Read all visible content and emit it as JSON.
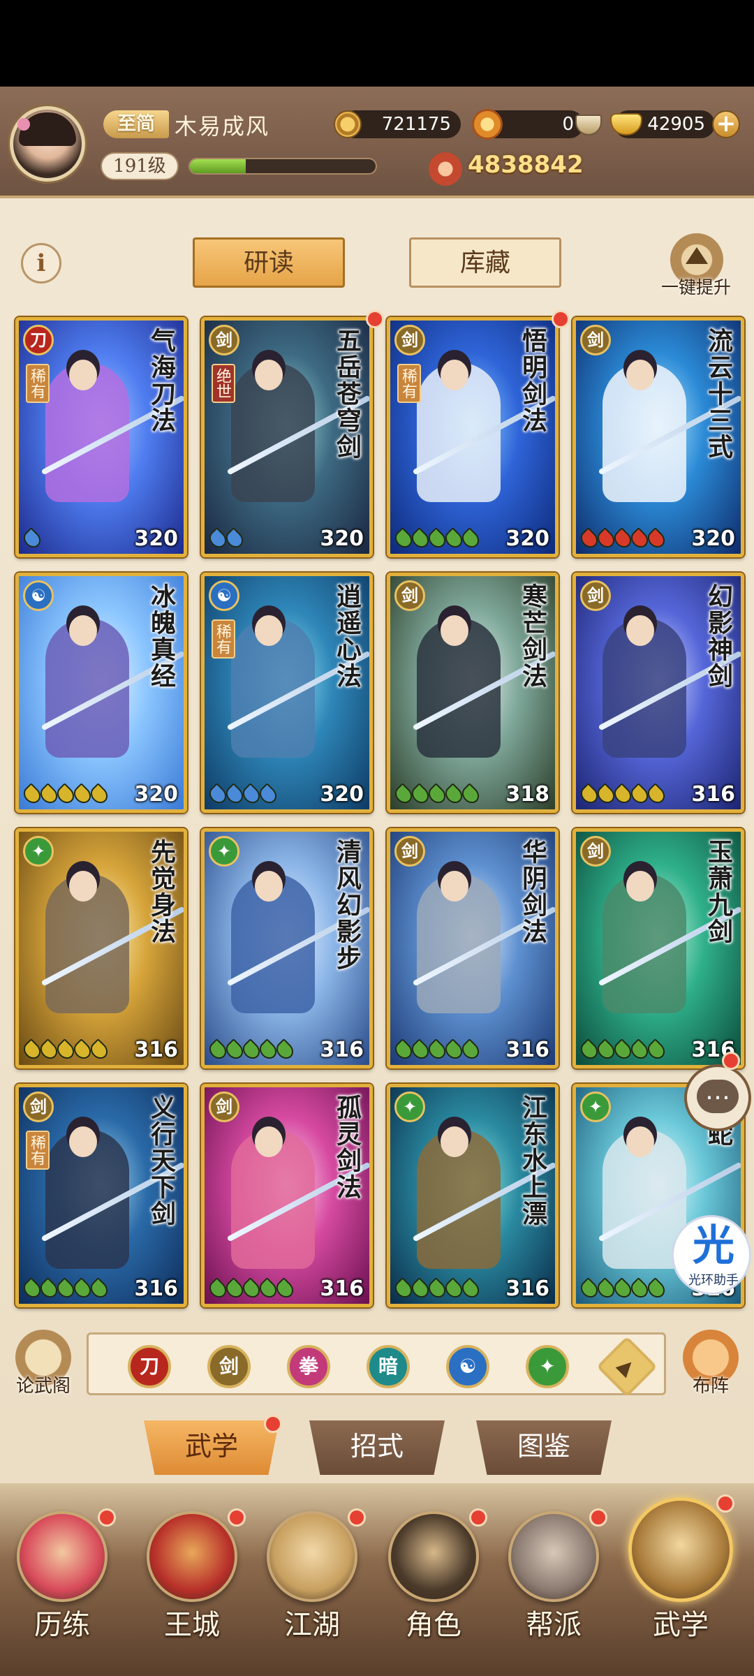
{
  "header": {
    "vip_label": "至简",
    "player_name": "木易成风",
    "level": "191级",
    "exp_progress": 0.3,
    "copper": "721175",
    "spirit": "0",
    "gold": "42905",
    "power": "4838842"
  },
  "tabs": {
    "study": "研读",
    "storage": "库藏",
    "info": "i",
    "upgrade_label": "一键提升"
  },
  "cards": [
    {
      "name": "气海刀法",
      "level": "320",
      "type": "blade",
      "type_glyph": "刀",
      "type_color": "#b8271d",
      "rarity": "稀有",
      "rarity_class": "rare",
      "stars": 1,
      "star_color": "#4a8ad8",
      "palette": [
        "#1d2a8c",
        "#4f7df0",
        "#a9c8ff"
      ],
      "figure": "#b36ee0",
      "badge": false
    },
    {
      "name": "五岳苍穹剑",
      "level": "320",
      "type": "sword",
      "type_glyph": "剑",
      "type_color": "#8a6a28",
      "rarity": "绝世",
      "rarity_class": "peerless",
      "stars": 2,
      "star_color": "#4a8ad8",
      "palette": [
        "#1b2640",
        "#3d6a82",
        "#9bd6d8"
      ],
      "figure": "#3a4452",
      "badge": true
    },
    {
      "name": "悟明剑法",
      "level": "320",
      "type": "sword",
      "type_glyph": "剑",
      "type_color": "#8a6a28",
      "rarity": "稀有",
      "rarity_class": "rare",
      "stars": 5,
      "star_color": "#5ba83a",
      "palette": [
        "#0d2a7a",
        "#2f64d8",
        "#8ad0ff"
      ],
      "figure": "#e8eef8",
      "badge": true
    },
    {
      "name": "流云十三式",
      "level": "320",
      "type": "sword",
      "type_glyph": "剑",
      "type_color": "#8a6a28",
      "rarity": "",
      "rarity_class": "",
      "stars": 5,
      "star_color": "#d83a2a",
      "palette": [
        "#0e2b6a",
        "#2b8ad6",
        "#b6eaff"
      ],
      "figure": "#f0f4fb",
      "badge": false
    },
    {
      "name": "冰魄真经",
      "level": "320",
      "type": "inner",
      "type_glyph": "☯",
      "type_color": "#2a6fc2",
      "rarity": "",
      "rarity_class": "",
      "stars": 5,
      "star_color": "#d8b42a",
      "palette": [
        "#3a7ad6",
        "#8cc6ff",
        "#eaf6ff"
      ],
      "figure": "#6b5fb8",
      "badge": false
    },
    {
      "name": "逍遥心法",
      "level": "320",
      "type": "inner",
      "type_glyph": "☯",
      "type_color": "#2a6fc2",
      "rarity": "稀有",
      "rarity_class": "rare",
      "stars": 4,
      "star_color": "#4a8ad8",
      "palette": [
        "#0e3a64",
        "#2e86b8",
        "#8fe0f0"
      ],
      "figure": "#4d7fb0",
      "badge": false
    },
    {
      "name": "寒芒剑法",
      "level": "318",
      "type": "sword",
      "type_glyph": "剑",
      "type_color": "#8a6a28",
      "rarity": "",
      "rarity_class": "",
      "stars": 5,
      "star_color": "#5ba83a",
      "palette": [
        "#2c3e2a",
        "#7fa89a",
        "#e8f2ee"
      ],
      "figure": "#2b3440",
      "badge": false
    },
    {
      "name": "幻影神剑",
      "level": "316",
      "type": "sword",
      "type_glyph": "剑",
      "type_color": "#8a6a28",
      "rarity": "",
      "rarity_class": "",
      "stars": 5,
      "star_color": "#d8b42a",
      "palette": [
        "#1c2470",
        "#5566d8",
        "#d6ddff"
      ],
      "figure": "#3a4380",
      "badge": false
    },
    {
      "name": "先觉身法",
      "level": "316",
      "type": "move",
      "type_glyph": "✦",
      "type_color": "#3a9a3a",
      "rarity": "",
      "rarity_class": "",
      "stars": 5,
      "star_color": "#d8b42a",
      "palette": [
        "#6a4a14",
        "#d6a43a",
        "#fff2b8"
      ],
      "figure": "#7a6a58",
      "badge": false
    },
    {
      "name": "清风幻影步",
      "level": "316",
      "type": "move",
      "type_glyph": "✦",
      "type_color": "#3a9a3a",
      "rarity": "",
      "rarity_class": "",
      "stars": 5,
      "star_color": "#5ba83a",
      "palette": [
        "#2a4c8a",
        "#8cb6e8",
        "#eaf2ff"
      ],
      "figure": "#3e64a8",
      "badge": false
    },
    {
      "name": "华阴剑法",
      "level": "316",
      "type": "sword",
      "type_glyph": "剑",
      "type_color": "#8a6a28",
      "rarity": "",
      "rarity_class": "",
      "stars": 5,
      "star_color": "#5ba83a",
      "palette": [
        "#1c3a74",
        "#5e90d0",
        "#e6f0ff"
      ],
      "figure": "#9aa8b8",
      "badge": false
    },
    {
      "name": "玉萧九剑",
      "level": "316",
      "type": "sword",
      "type_glyph": "剑",
      "type_color": "#8a6a28",
      "rarity": "",
      "rarity_class": "",
      "stars": 5,
      "star_color": "#5ba83a",
      "palette": [
        "#0b4a3a",
        "#2fb08a",
        "#c6f6e2"
      ],
      "figure": "#4a8a6a",
      "badge": false
    },
    {
      "name": "义行天下剑",
      "level": "316",
      "type": "sword",
      "type_glyph": "剑",
      "type_color": "#8a6a28",
      "rarity": "稀有",
      "rarity_class": "rare",
      "stars": 5,
      "star_color": "#5ba83a",
      "palette": [
        "#0e2c5a",
        "#2a6aa8",
        "#a6d8f0"
      ],
      "figure": "#2a3650",
      "badge": false
    },
    {
      "name": "孤灵剑法",
      "level": "316",
      "type": "sword",
      "type_glyph": "剑",
      "type_color": "#8a6a28",
      "rarity": "",
      "rarity_class": "",
      "stars": 5,
      "star_color": "#5ba83a",
      "palette": [
        "#6a1050",
        "#d64aa0",
        "#ffd6f0"
      ],
      "figure": "#e06a9a",
      "badge": false
    },
    {
      "name": "江东水上漂",
      "level": "316",
      "type": "move",
      "type_glyph": "✦",
      "type_color": "#3a9a3a",
      "rarity": "",
      "rarity_class": "",
      "stars": 5,
      "star_color": "#5ba83a",
      "palette": [
        "#0a2c4a",
        "#2a8aa0",
        "#8ee6e0"
      ],
      "figure": "#8a6a3a",
      "badge": false
    },
    {
      "name": "雪蛇",
      "level": "316",
      "type": "move",
      "type_glyph": "✦",
      "type_color": "#3a9a3a",
      "rarity": "",
      "rarity_class": "",
      "stars": 5,
      "star_color": "#5ba83a",
      "palette": [
        "#1a5a7a",
        "#6ac8d8",
        "#eafcff"
      ],
      "figure": "#d8e6ec",
      "badge": false
    }
  ],
  "filters": [
    {
      "name": "blade",
      "glyph": "刀",
      "color": "#b8271d"
    },
    {
      "name": "sword",
      "glyph": "剑",
      "color": "#8a6a28"
    },
    {
      "name": "fist",
      "glyph": "拳",
      "color": "#c23a7a"
    },
    {
      "name": "hidden",
      "glyph": "暗",
      "color": "#1e8a8a"
    },
    {
      "name": "inner",
      "glyph": "☯",
      "color": "#2a6fc2"
    },
    {
      "name": "move",
      "glyph": "✦",
      "color": "#3a9a3a"
    },
    {
      "name": "up",
      "glyph": "▲",
      "color": "#e8c46a"
    }
  ],
  "side_buttons": {
    "left": "论武阁",
    "right": "布阵"
  },
  "sub_tabs": [
    "武学",
    "招式",
    "图鉴"
  ],
  "nav": [
    {
      "label": "历练",
      "colors": [
        "#d84a5a",
        "#f2c8a0"
      ]
    },
    {
      "label": "王城",
      "colors": [
        "#b8302a",
        "#e8a85a"
      ]
    },
    {
      "label": "江湖",
      "colors": [
        "#c8a060",
        "#f2d8a8"
      ]
    },
    {
      "label": "角色",
      "colors": [
        "#4a3a2a",
        "#d8b88a"
      ]
    },
    {
      "label": "帮派",
      "colors": [
        "#8a7a70",
        "#d8c8b8"
      ]
    },
    {
      "label": "武学",
      "colors": [
        "#a87a3a",
        "#f2d8a0"
      ]
    }
  ],
  "floating": {
    "chat": "…",
    "assist_glyph": "光",
    "assist_label": "光环助手"
  }
}
